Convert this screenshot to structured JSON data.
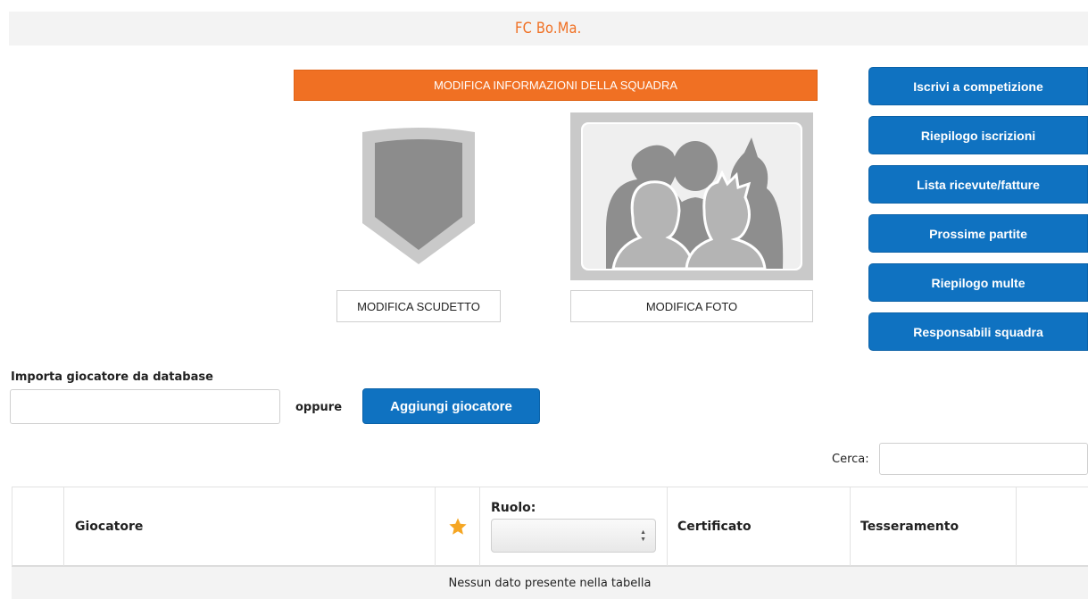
{
  "team": {
    "name": "FC Bo.Ma."
  },
  "buttons": {
    "edit_info": "MODIFICA INFORMAZIONI DELLA SQUADRA",
    "edit_crest": "MODIFICA SCUDETTO",
    "edit_photo": "MODIFICA FOTO",
    "add_player": "Aggiungi giocatore"
  },
  "side_actions": [
    "Iscrivi a competizione",
    "Riepilogo iscrizioni",
    "Lista ricevute/fatture",
    "Prossime partite",
    "Riepilogo multe",
    "Responsabili squadra"
  ],
  "import": {
    "label": "Importa giocatore da database",
    "value": "",
    "or": "oppure"
  },
  "search": {
    "label": "Cerca:",
    "value": ""
  },
  "table": {
    "columns": [
      "",
      "Giocatore",
      "star-icon",
      "Ruolo:",
      "Certificato",
      "Tesseramento",
      ""
    ],
    "role_filter_value": "",
    "empty_message": "Nessun dato presente nella tabella"
  },
  "colors": {
    "accent_orange": "#f07023",
    "primary_blue": "#0f72c1",
    "star": "#f5a623"
  }
}
